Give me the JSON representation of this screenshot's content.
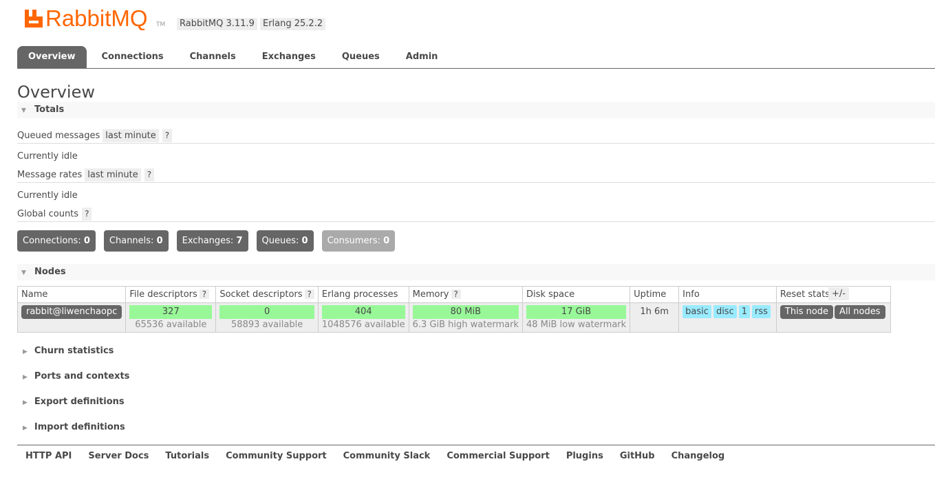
{
  "header": {
    "logo_text": "RabbitMQ",
    "logo_tm": "TM",
    "version_badge": "RabbitMQ 3.11.9",
    "erlang_badge": "Erlang 25.2.2"
  },
  "tabs": [
    {
      "label": "Overview",
      "active": true
    },
    {
      "label": "Connections"
    },
    {
      "label": "Channels"
    },
    {
      "label": "Exchanges"
    },
    {
      "label": "Queues"
    },
    {
      "label": "Admin"
    }
  ],
  "page_title": "Overview",
  "totals": {
    "section_label": "Totals",
    "queued_label": "Queued messages",
    "queued_range": "last minute",
    "help": "?",
    "queued_status": "Currently idle",
    "rates_label": "Message rates",
    "rates_range": "last minute",
    "rates_status": "Currently idle",
    "global_label": "Global counts"
  },
  "counts": [
    {
      "label": "Connections:",
      "value": "0"
    },
    {
      "label": "Channels:",
      "value": "0"
    },
    {
      "label": "Exchanges:",
      "value": "7"
    },
    {
      "label": "Queues:",
      "value": "0"
    },
    {
      "label": "Consumers:",
      "value": "0"
    }
  ],
  "nodes": {
    "section_label": "Nodes",
    "columns": [
      "Name",
      "File descriptors",
      "Socket descriptors",
      "Erlang processes",
      "Memory",
      "Disk space",
      "Uptime",
      "Info",
      "Reset stats"
    ],
    "toggle_label": "+/-",
    "row": {
      "name": "rabbit@liwenchaopc",
      "file_descriptors": "327",
      "file_descriptors_avail": "65536 available",
      "socket_descriptors": "0",
      "socket_descriptors_avail": "58893 available",
      "erlang_processes": "404",
      "erlang_processes_avail": "1048576 available",
      "memory": "80 MiB",
      "memory_watermark": "6.3 GiB high watermark",
      "disk_space": "17 GiB",
      "disk_watermark": "48 MiB low watermark",
      "uptime": "1h 6m",
      "info_tags": [
        "basic",
        "disc",
        "1",
        "rss"
      ],
      "reset_this": "This node",
      "reset_all": "All nodes"
    }
  },
  "collapsed_sections": [
    "Churn statistics",
    "Ports and contexts",
    "Export definitions",
    "Import definitions"
  ],
  "footer_links": [
    "HTTP API",
    "Server Docs",
    "Tutorials",
    "Community Support",
    "Community Slack",
    "Commercial Support",
    "Plugins",
    "GitHub",
    "Changelog"
  ],
  "colors": {
    "brand_orange": "#ff6600",
    "tab_active": "#666666",
    "bar_green": "#98f898",
    "tag_blue": "#99ebff"
  }
}
